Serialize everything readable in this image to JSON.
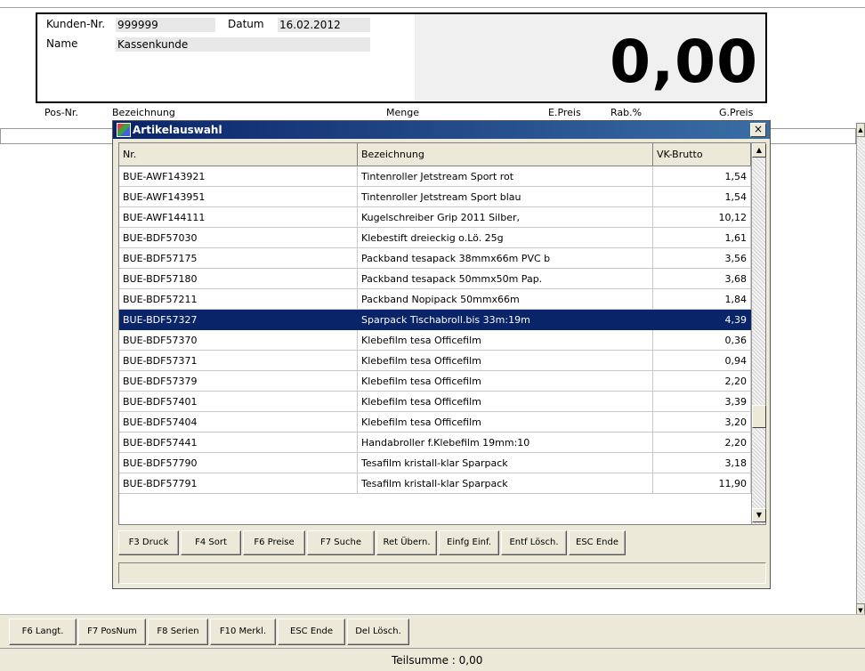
{
  "header": {
    "customer_no_label": "Kunden-Nr.",
    "customer_no": "999999",
    "date_label": "Datum",
    "date": "16.02.2012",
    "name_label": "Name",
    "name": "Kassenkunde",
    "total": "0,00"
  },
  "columns": {
    "pos": "Pos-Nr.",
    "desc": "Bezeichnung",
    "qty": "Menge",
    "unit_price": "E.Preis",
    "discount": "Rab.%",
    "total_price": "G.Preis"
  },
  "dialog": {
    "title": "Artikelauswahl",
    "close": "×",
    "grid_headers": {
      "nr": "Nr.",
      "desc": "Bezeichnung",
      "price": "VK-Brutto"
    },
    "rows": [
      {
        "nr": "BUE-AWF143921",
        "desc": "Tintenroller Jetstream Sport rot",
        "price": "1,54"
      },
      {
        "nr": "BUE-AWF143951",
        "desc": "Tintenroller Jetstream Sport blau",
        "price": "1,54"
      },
      {
        "nr": "BUE-AWF144111",
        "desc": "Kugelschreiber Grip 2011 Silber,",
        "price": "10,12"
      },
      {
        "nr": "BUE-BDF57030",
        "desc": "Klebestift dreieckig o.Lö. 25g",
        "price": "1,61"
      },
      {
        "nr": "BUE-BDF57175",
        "desc": "Packband tesapack 38mmx66m PVC b",
        "price": "3,56"
      },
      {
        "nr": "BUE-BDF57180",
        "desc": "Packband tesapack 50mmx50m Pap.",
        "price": "3,68"
      },
      {
        "nr": "BUE-BDF57211",
        "desc": "Packband Nopipack 50mmx66m",
        "price": "1,84"
      },
      {
        "nr": "BUE-BDF57327",
        "desc": "Sparpack Tischabroll.bis 33m:19m",
        "price": "4,39"
      },
      {
        "nr": "BUE-BDF57370",
        "desc": "Klebefilm tesa Officefilm",
        "price": "0,36"
      },
      {
        "nr": "BUE-BDF57371",
        "desc": "Klebefilm tesa Officefilm",
        "price": "0,94"
      },
      {
        "nr": "BUE-BDF57379",
        "desc": "Klebefilm tesa Officefilm",
        "price": "2,20"
      },
      {
        "nr": "BUE-BDF57401",
        "desc": "Klebefilm tesa Officefilm",
        "price": "3,39"
      },
      {
        "nr": "BUE-BDF57404",
        "desc": "Klebefilm tesa Officefilm",
        "price": "3,20"
      },
      {
        "nr": "BUE-BDF57441",
        "desc": "Handabroller f.Klebefilm 19mm:10",
        "price": "2,20"
      },
      {
        "nr": "BUE-BDF57790",
        "desc": "Tesafilm kristall-klar Sparpack",
        "price": "3,18"
      },
      {
        "nr": "BUE-BDF57791",
        "desc": "Tesafilm kristall-klar Sparpack",
        "price": "11,90"
      }
    ],
    "selected_index": 7,
    "buttons": [
      "F3 Druck",
      "F4 Sort",
      "F6 Preise",
      "F7 Suche",
      "Ret Übern.",
      "Einfg Einf.",
      "Entf Lösch.",
      "ESC Ende"
    ]
  },
  "bottom_buttons": [
    "F6 Langt.",
    "F7 PosNum",
    "F8 Serien",
    "F10 Merkl.",
    "ESC Ende",
    "Del Lösch."
  ],
  "status": "Teilsumme : 0,00",
  "colors": {
    "selection": "#0a246a",
    "face": "#ece9d8"
  }
}
